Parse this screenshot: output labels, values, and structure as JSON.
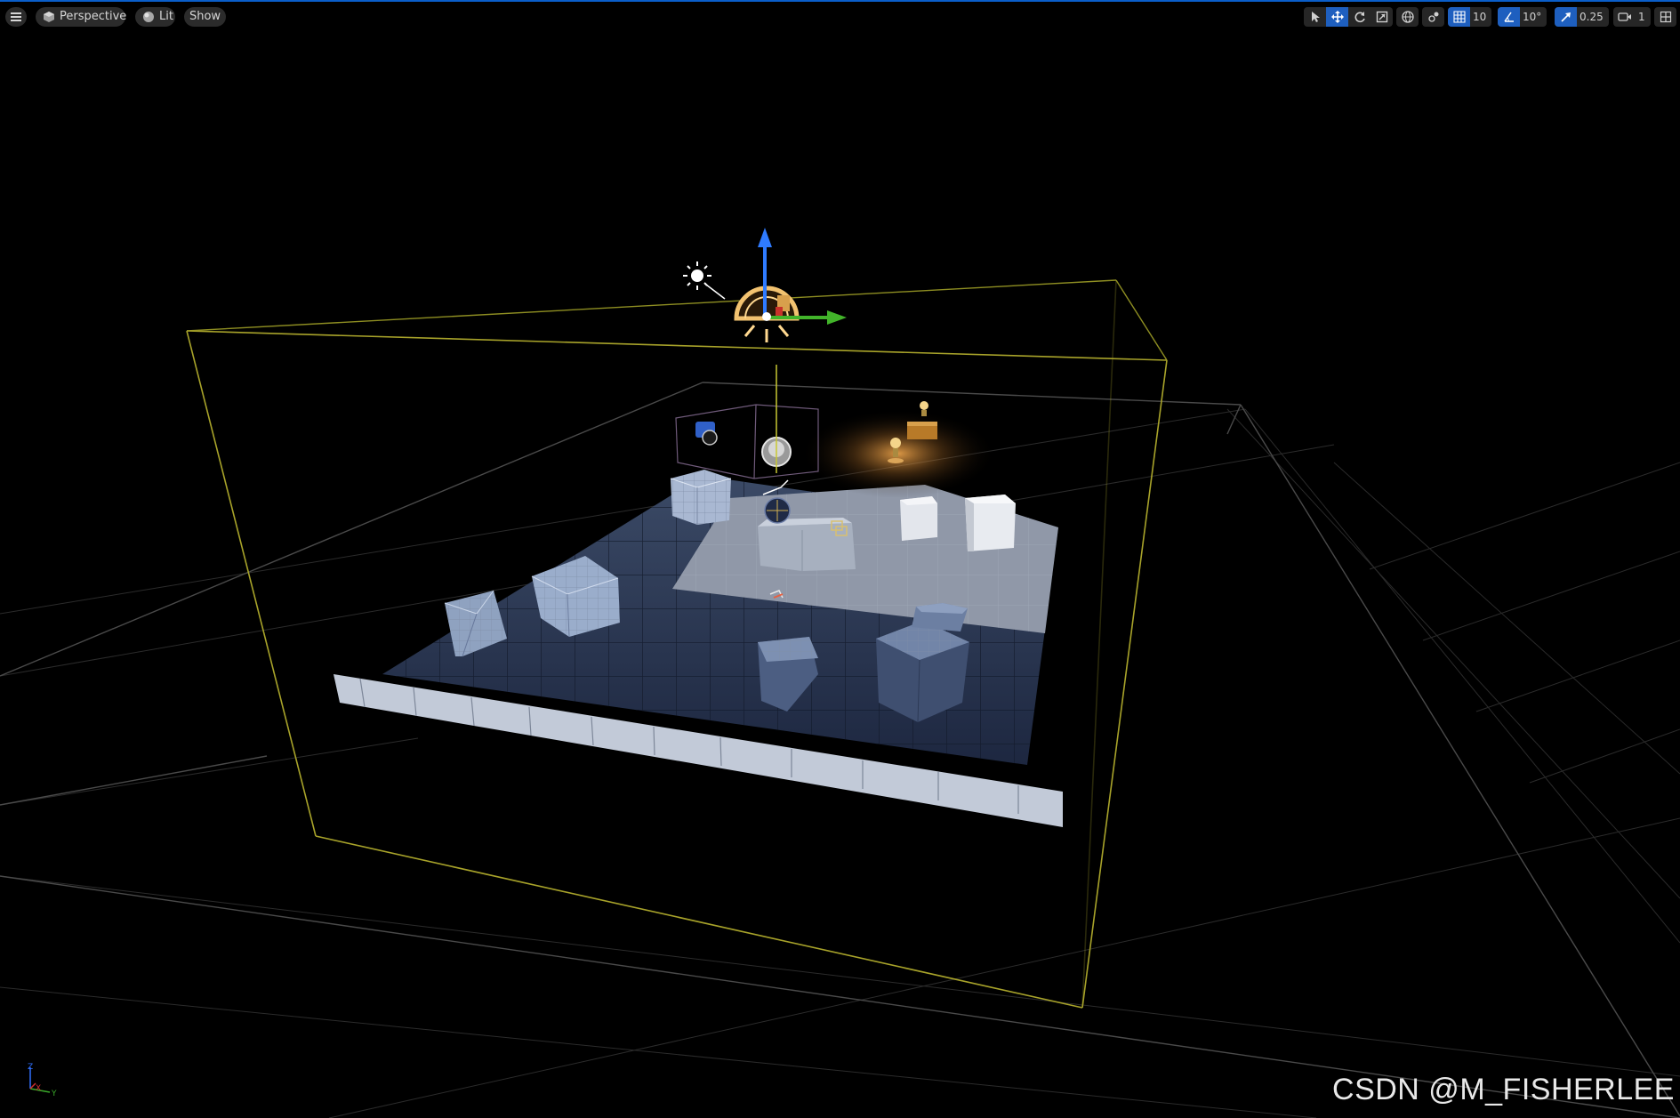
{
  "viewport": {
    "menu_icon": "hamburger-icon",
    "view_mode": {
      "label": "Perspective",
      "icon": "cube-icon"
    },
    "lighting_mode": {
      "label": "Lit",
      "icon": "sphere-icon"
    },
    "show_label": "Show"
  },
  "toolbar": {
    "tools": [
      {
        "name": "select",
        "icon": "cursor-icon",
        "active": false
      },
      {
        "name": "translate",
        "icon": "move-icon",
        "active": true
      },
      {
        "name": "rotate",
        "icon": "rotate-icon",
        "active": false
      },
      {
        "name": "scale",
        "icon": "scale-icon",
        "active": false
      }
    ],
    "coordinate_space_icon": "globe-icon",
    "surface_snap_icon": "surface-snap-icon",
    "grid_snap": {
      "icon": "grid-icon",
      "value": "10",
      "active": true
    },
    "rotation_snap": {
      "icon": "angle-icon",
      "value": "10°",
      "active": true
    },
    "scale_snap": {
      "icon": "scale-snap-icon",
      "value": "0.25",
      "active": true
    },
    "camera_speed": {
      "icon": "camera-icon",
      "value": "1"
    },
    "layout_icon": "viewport-layout-icon"
  },
  "axis_indicator": {
    "x": "X",
    "y": "Y",
    "z": "Z"
  },
  "watermark": "CSDN @M_FISHERLEE",
  "colors": {
    "accent": "#1e5fbf",
    "selection": "#c8c832",
    "gizmo_z": "#2f7bff",
    "gizmo_y": "#42b42a"
  }
}
